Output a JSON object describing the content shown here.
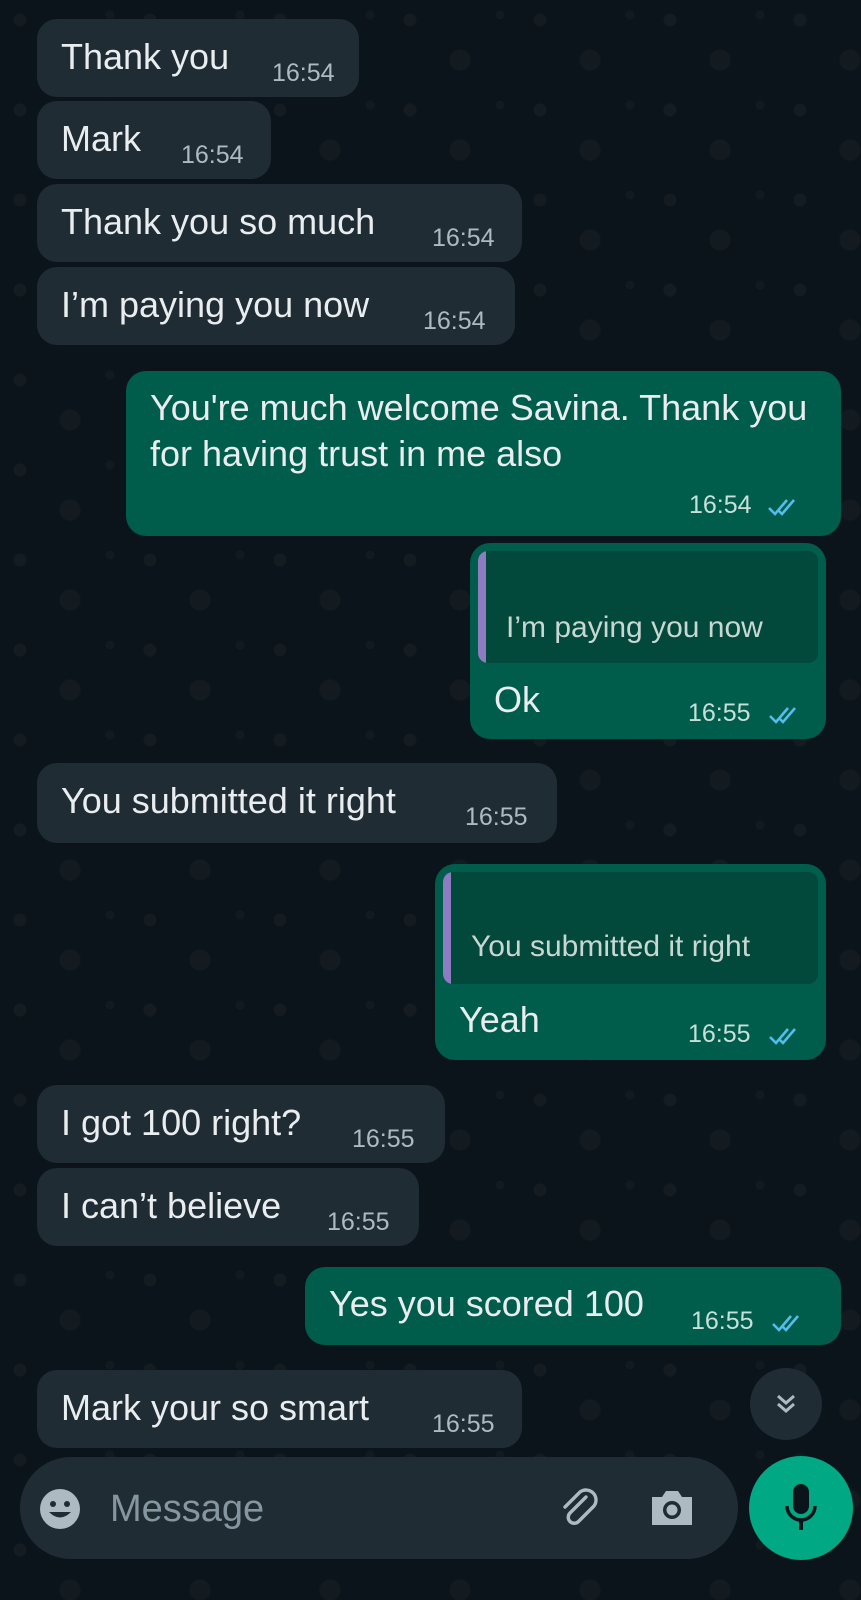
{
  "colors": {
    "chat_background": "#0b141a",
    "incoming_bubble": "#1f2c34",
    "outgoing_bubble": "#005c4b",
    "read_ticks": "#53bdeb",
    "mic_button": "#00a884"
  },
  "messages": [
    {
      "direction": "incoming",
      "text": "Thank you",
      "time": "16:54"
    },
    {
      "direction": "incoming",
      "text": "Mark",
      "time": "16:54"
    },
    {
      "direction": "incoming",
      "text": "Thank you so much",
      "time": "16:54"
    },
    {
      "direction": "incoming",
      "text": "I’m paying you now",
      "time": "16:54"
    },
    {
      "direction": "outgoing",
      "text": "You're much welcome Savina. Thank you for having trust in me also",
      "time": "16:54",
      "status": "read"
    },
    {
      "direction": "outgoing",
      "quoted": "I’m paying you now",
      "text": "Ok",
      "time": "16:55",
      "status": "read"
    },
    {
      "direction": "incoming",
      "text": "You submitted it right",
      "time": "16:55"
    },
    {
      "direction": "outgoing",
      "quoted": "You submitted it right",
      "text": "Yeah",
      "time": "16:55",
      "status": "read"
    },
    {
      "direction": "incoming",
      "text": "I got 100 right?",
      "time": "16:55"
    },
    {
      "direction": "incoming",
      "text": "I can’t believe",
      "time": "16:55"
    },
    {
      "direction": "outgoing",
      "text": "Yes you scored 100",
      "time": "16:55",
      "status": "read"
    },
    {
      "direction": "incoming",
      "text": "Mark your so smart",
      "time": "16:55"
    }
  ],
  "composer": {
    "placeholder": "Message",
    "emoji_icon": "emoji-icon",
    "attach_icon": "paperclip-icon",
    "camera_icon": "camera-icon",
    "mic_icon": "microphone-icon"
  },
  "scroll_button_icon": "double-chevron-down-icon"
}
